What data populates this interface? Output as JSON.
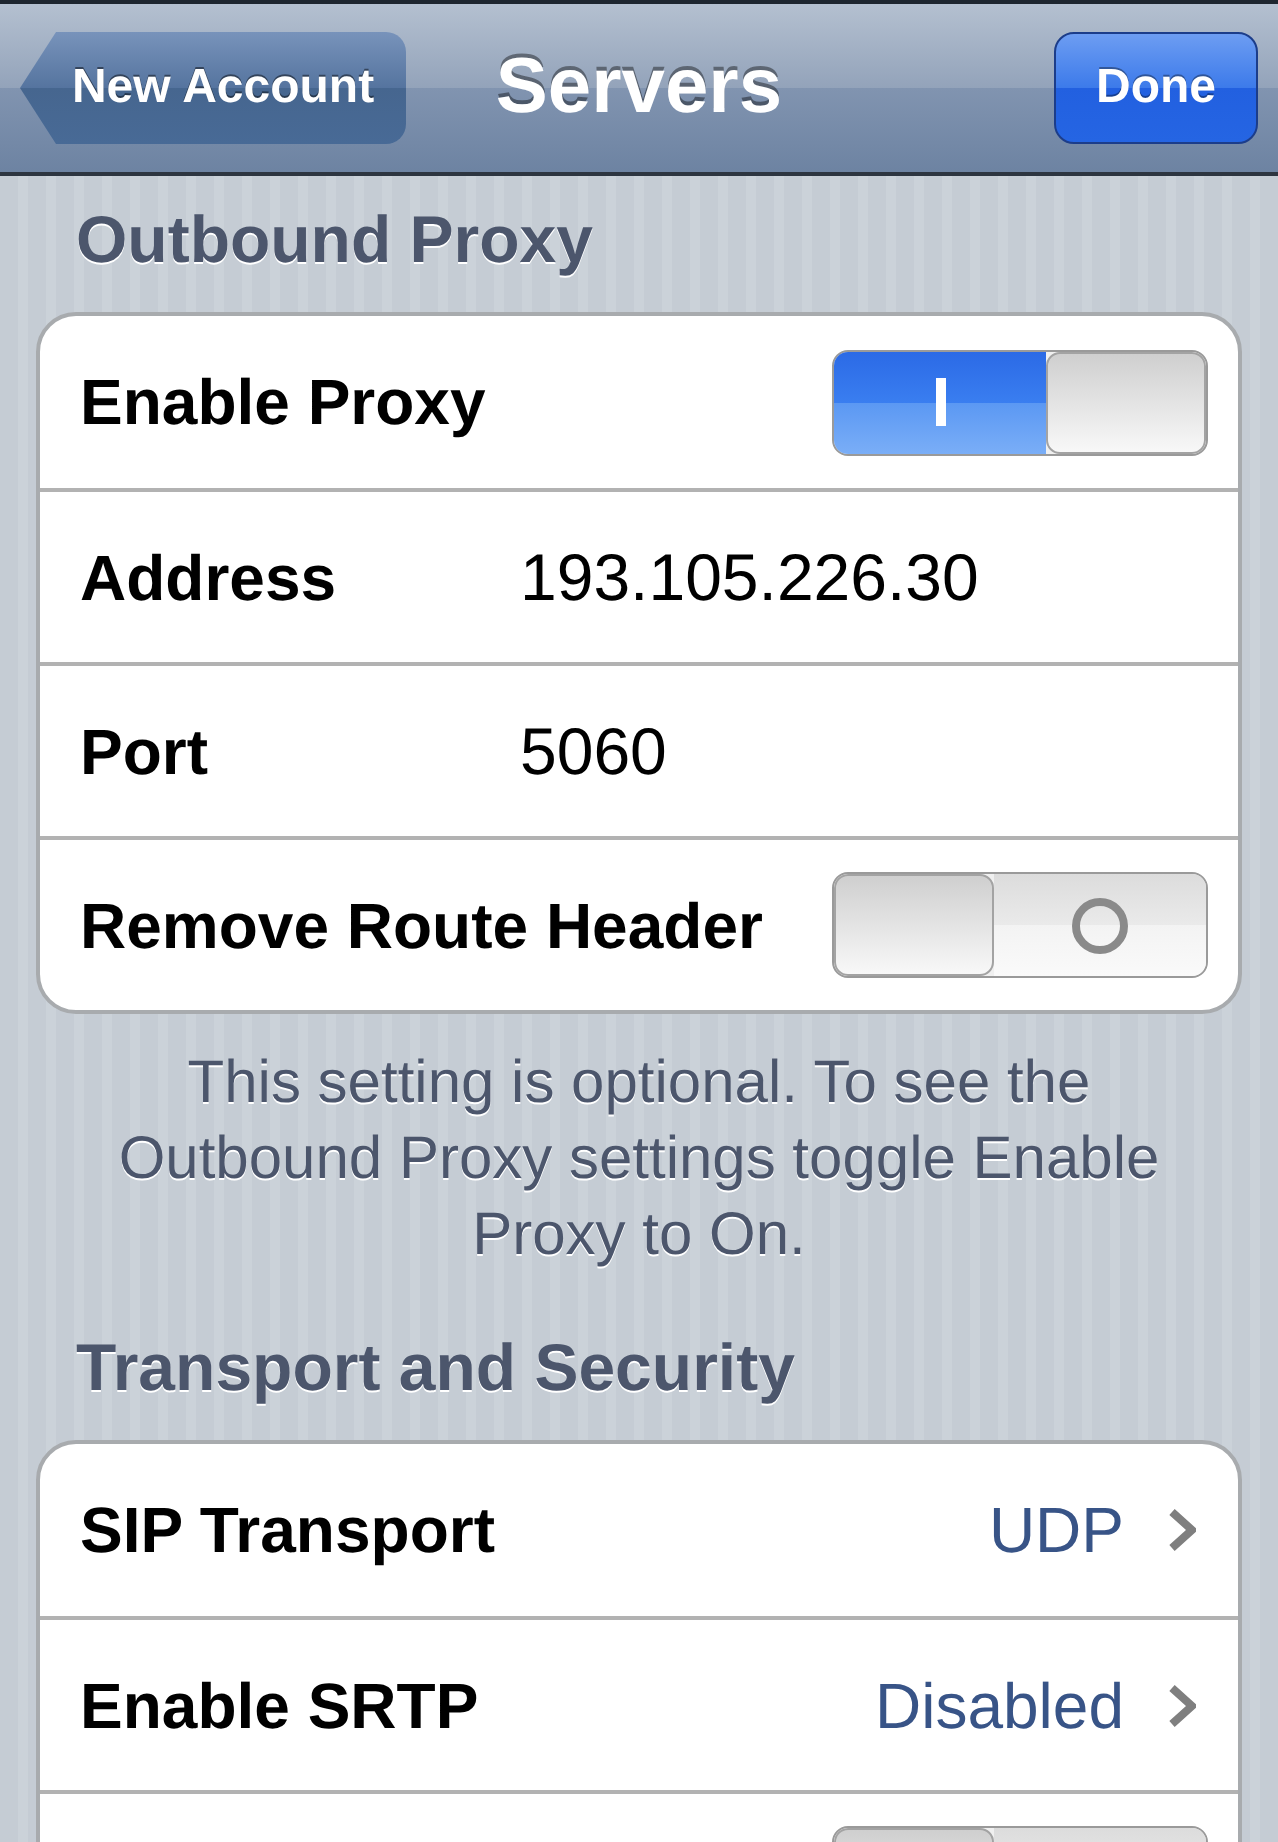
{
  "nav_bar": {
    "back_button": "New Account",
    "title": "Servers",
    "done_button": "Done"
  },
  "sections": [
    {
      "header": "Outbound Proxy",
      "rows": [
        {
          "kind": "toggle",
          "label": "Enable Proxy",
          "on": true
        },
        {
          "kind": "field",
          "label": "Address",
          "value": "193.105.226.30"
        },
        {
          "kind": "field",
          "label": "Port",
          "value": "5060"
        },
        {
          "kind": "toggle",
          "label": "Remove Route Header",
          "on": false
        }
      ],
      "footer": "This setting is optional. To see the Outbound Proxy settings toggle Enable Proxy to On."
    },
    {
      "header": "Transport and Security",
      "rows": [
        {
          "kind": "disclosure",
          "label": "SIP Transport",
          "value": "UDP"
        },
        {
          "kind": "disclosure",
          "label": "Enable SRTP",
          "value": "Disabled"
        },
        {
          "kind": "toggle",
          "on": false
        }
      ]
    }
  ]
}
